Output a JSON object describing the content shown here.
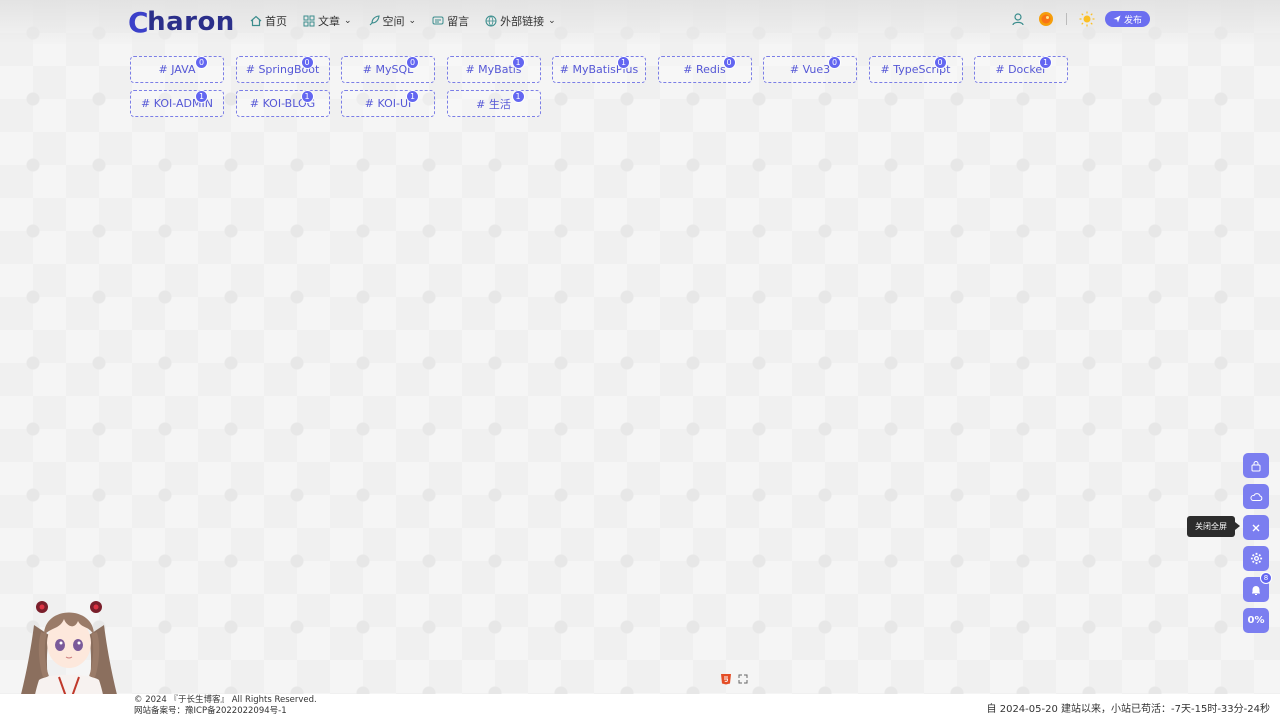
{
  "brand": {
    "logo_c": "C",
    "logo_rest": "haron"
  },
  "nav": [
    {
      "label": "首页",
      "icon": "home-icon",
      "dropdown": false
    },
    {
      "label": "文章",
      "icon": "grid-icon",
      "dropdown": true
    },
    {
      "label": "空间",
      "icon": "rocket-icon",
      "dropdown": true
    },
    {
      "label": "留言",
      "icon": "message-icon",
      "dropdown": false
    },
    {
      "label": "外部链接",
      "icon": "globe-icon",
      "dropdown": true
    }
  ],
  "header": {
    "publish_label": "发布"
  },
  "tags": [
    {
      "label": "# JAVA",
      "count": "0"
    },
    {
      "label": "# SpringBoot",
      "count": "0"
    },
    {
      "label": "# MySQL",
      "count": "0"
    },
    {
      "label": "# MyBatis",
      "count": "1"
    },
    {
      "label": "# MyBatisPlus",
      "count": "1"
    },
    {
      "label": "# Redis",
      "count": "0"
    },
    {
      "label": "# Vue3",
      "count": "0"
    },
    {
      "label": "# TypeScript",
      "count": "0"
    },
    {
      "label": "# Docker",
      "count": "1"
    },
    {
      "label": "# KOI-ADMIN",
      "count": "1"
    },
    {
      "label": "# KOI-BLOG",
      "count": "1"
    },
    {
      "label": "# KOI-UI",
      "count": "1"
    },
    {
      "label": "# 生活",
      "count": "1"
    }
  ],
  "float": {
    "tooltip": "关闭全屏",
    "notification_count": "8",
    "scroll_percent": "0%"
  },
  "footer": {
    "copyright": "© 2024 『于长生博客』 All Rights Reserved.",
    "icp": "网站备案号：豫ICP备2022022094号-1",
    "uptime": "自 2024-05-20 建站以来，小站已苟活：-7天-15时-33分-24秒"
  },
  "colors": {
    "accent": "#6b6ef0",
    "brand": "#2b2f8a",
    "tag_text": "#5557d6"
  }
}
